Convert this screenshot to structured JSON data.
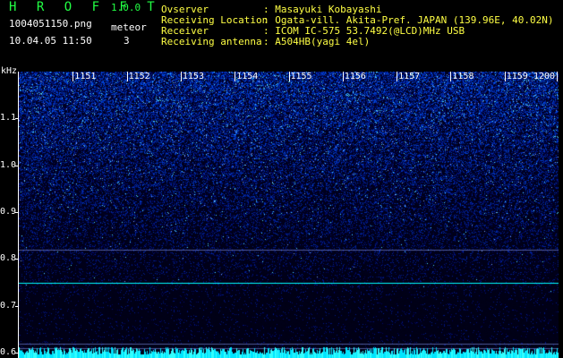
{
  "header": {
    "app_title": "H R O F F T",
    "app_version": "1.0.0",
    "filename": "1004051150.png",
    "timestamp": "10.04.05 11:50",
    "detector_label": "meteor",
    "detector_count": "3"
  },
  "station": {
    "observer_label": "Ovserver",
    "observer_value": ": Masayuki Kobayashi",
    "location_label": "Receiving Location",
    "location_value": ": Ogata-vill. Akita-Pref. JAPAN (139.96E, 40.02N)",
    "receiver_label": "Receiver",
    "receiver_value": ": ICOM IC-575 53.7492(@LCD)MHz USB",
    "antenna_label": "Receiving antenna",
    "antenna_value": ": A504HB(yagi 4el)"
  },
  "plot": {
    "unit_label": "kHz",
    "y_ticks": [
      {
        "label": "1.1",
        "value": 1.1
      },
      {
        "label": "1.0",
        "value": 1.0
      },
      {
        "label": "0.9",
        "value": 0.9
      },
      {
        "label": "0.8",
        "value": 0.8
      },
      {
        "label": "0.7",
        "value": 0.7
      },
      {
        "label": "0.6",
        "value": 0.6
      }
    ],
    "x_ticks": [
      "1151",
      "1152",
      "1153",
      "1154",
      "1155",
      "1156",
      "1157",
      "1158",
      "1159",
      "1200"
    ],
    "x_start": "1150",
    "y_range_khz": [
      0.58,
      1.22
    ],
    "colors": {
      "text": "#ffffff",
      "title_green": "#22ff44",
      "tick_yellow": "#ffff44",
      "signal_cyan": "#00ffff",
      "noise_blue": "#1f3fff"
    },
    "signal_lines_khz": [
      0.82,
      0.75,
      0.62,
      0.61
    ]
  }
}
